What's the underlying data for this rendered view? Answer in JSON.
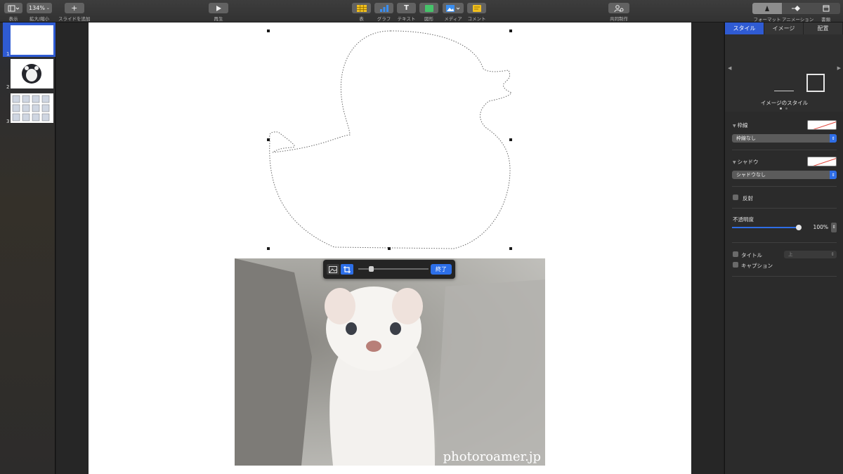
{
  "toolbar": {
    "view_label": "表示",
    "zoom_value": "134%",
    "zoom_label": "拡大/縮小",
    "add_slide_label": "スライドを追加",
    "play_label": "再生",
    "table_label": "表",
    "chart_label": "グラフ",
    "text_label": "テキスト",
    "shape_label": "図形",
    "media_label": "メディア",
    "comment_label": "コメント",
    "collaborate_label": "共同制作",
    "format_label": "フォーマット",
    "animate_label": "アニメーション",
    "document_label": "書類"
  },
  "navigator": {
    "slides": [
      {
        "number": "1",
        "selected": true
      },
      {
        "number": "2",
        "selected": false
      },
      {
        "number": "3",
        "selected": false
      }
    ]
  },
  "canvas": {
    "photo_credit": "photoroamer.jp",
    "mask_done_label": "終了",
    "mask_zoom": 0.15
  },
  "inspector": {
    "tabs": [
      "スタイル",
      "イメージ",
      "配置"
    ],
    "active_tab": "スタイル",
    "image_style_label": "イメージのスタイル",
    "border": {
      "title": "枠線",
      "value": "枠線なし"
    },
    "shadow": {
      "title": "シャドウ",
      "value": "シャドウなし"
    },
    "reflection": {
      "label": "反射",
      "checked": false
    },
    "opacity": {
      "title": "不透明度",
      "value_text": "100%",
      "value": 1.0
    },
    "title_check": {
      "label": "タイトル",
      "checked": false,
      "select_value": "上"
    },
    "caption_check": {
      "label": "キャプション",
      "checked": false
    }
  },
  "colors": {
    "accent": "#2f5bd3",
    "toolbar_bg": "#383838",
    "inspector_bg": "#2b2b2b"
  }
}
